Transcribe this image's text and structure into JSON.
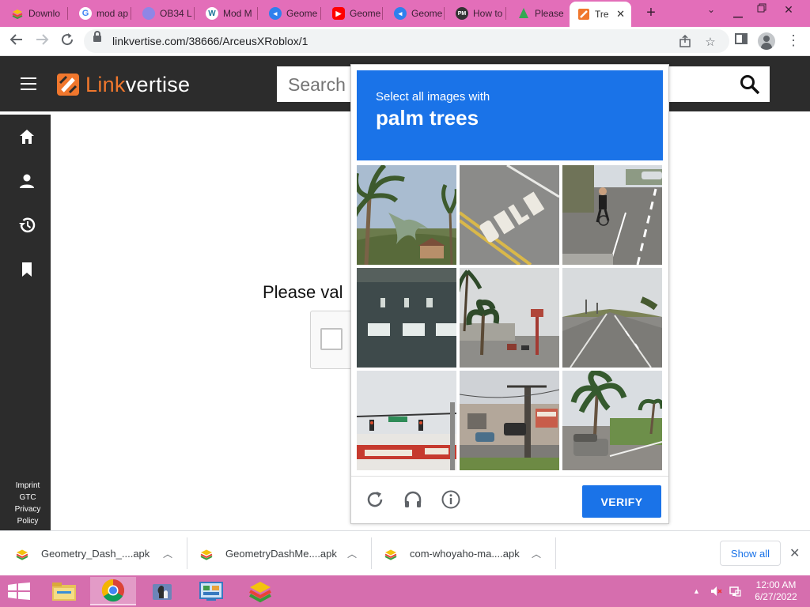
{
  "browser": {
    "tabs": [
      {
        "label": "Downlo",
        "icon": "bluestacks-icon",
        "color": "#6fb43f"
      },
      {
        "label": "mod ap",
        "icon": "google-icon",
        "color": "#4285f4"
      },
      {
        "label": "OB34 L",
        "icon": "globe-icon",
        "color": "#6a5acd"
      },
      {
        "label": "Mod M",
        "icon": "wordpress-icon",
        "color": "#21759b"
      },
      {
        "label": "Geome",
        "icon": "link-icon",
        "color": "#2f80ed"
      },
      {
        "label": "Geome",
        "icon": "youtube-icon",
        "color": "#ff0000"
      },
      {
        "label": "Geome",
        "icon": "link-icon",
        "color": "#2f80ed"
      },
      {
        "label": "How to",
        "icon": "pm-icon",
        "color": "#333333"
      },
      {
        "label": "Please",
        "icon": "leaf-icon",
        "color": "#34a853"
      },
      {
        "label": "Tre",
        "icon": "linkvertise-icon",
        "color": "#f0772d",
        "active": true
      }
    ],
    "url": "linkvertise.com/38666/ArceusXRoblox/1"
  },
  "site": {
    "logo_part1": "Link",
    "logo_part2": "vertise",
    "search_placeholder": "Search",
    "footer_links": [
      "Imprint",
      "GTC",
      "Privacy",
      "Policy"
    ],
    "validate_text": "Please val",
    "accent": "#f0772d"
  },
  "captcha": {
    "instruction": "Select all images with",
    "target": "palm trees",
    "verify_label": "VERIFY",
    "accent": "#1a73e8",
    "tiles": [
      "palm-tree-house",
      "road-only-marking",
      "cyclist-road",
      "crosswalk-road",
      "palm-tree-street",
      "straight-road",
      "traffic-light-intersection",
      "utility-pole-building",
      "palm-tree-parking"
    ]
  },
  "downloads": {
    "items": [
      {
        "name": "Geometry_Dash_....apk"
      },
      {
        "name": "GeometryDashMe....apk"
      },
      {
        "name": "com-whoyaho-ma....apk"
      }
    ],
    "show_all_label": "Show all"
  },
  "taskbar": {
    "time": "12:00 AM",
    "date": "6/27/2022",
    "apps": [
      "file-explorer-icon",
      "chrome-icon",
      "chess-icon",
      "control-panel-icon",
      "bluestacks-icon"
    ]
  }
}
